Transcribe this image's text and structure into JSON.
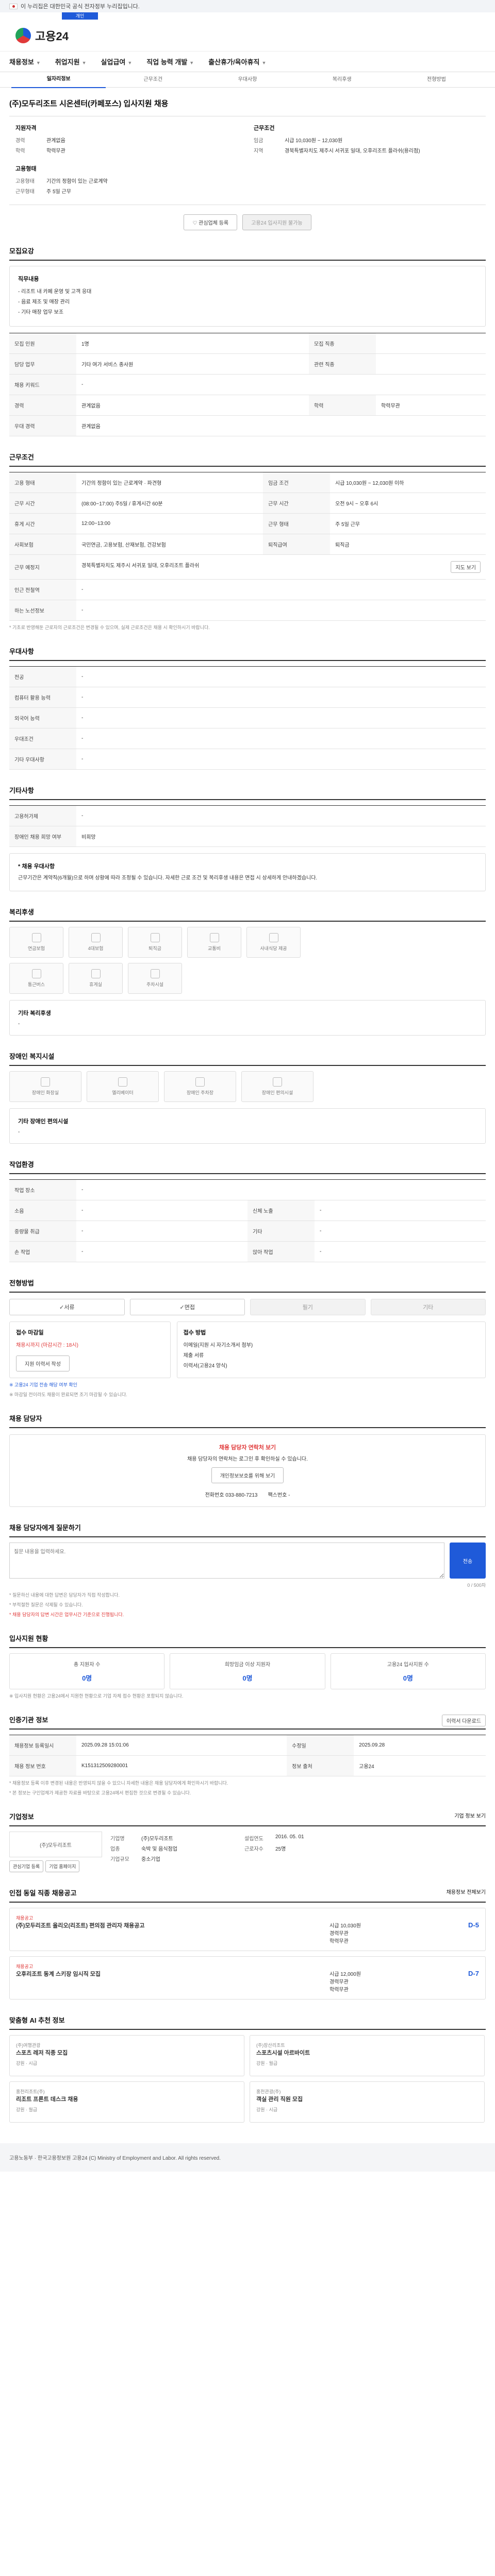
{
  "gov_bar": {
    "text": "이 누리집은 대한민국 공식 전자정부 누리집입니다."
  },
  "top_tab": {
    "label": "개인"
  },
  "logo": {
    "text": "고용24"
  },
  "gnb": [
    "채용정보",
    "취업지원",
    "실업급여",
    "직업 능력 개발",
    "출산휴가/육아휴직"
  ],
  "subnav": [
    "일자리정보",
    "근무조건",
    "우대사항",
    "복리후생",
    "전형방법"
  ],
  "page": {
    "title": "(주)모두리조트 시온센터(카페포스) 입사지원 채용"
  },
  "summary": {
    "left_head": "지원자격",
    "left": [
      {
        "k": "경력",
        "v": "관계없음"
      },
      {
        "k": "학력",
        "v": "학력무관"
      }
    ],
    "right_head": "근무조건",
    "right": [
      {
        "k": "임금",
        "v": "시급 10,030원 ~ 12,030원"
      },
      {
        "k": "지역",
        "v": "경북특별자치도 제주시 서귀포 일대, 오후리조트 플라쉬(용리점)"
      }
    ],
    "left2_head": "고용형태",
    "left2": [
      {
        "k": "고용형태",
        "v": "기간의 정함이 있는 근로계약"
      },
      {
        "k": "근무형태",
        "v": "주 5일 근무"
      }
    ]
  },
  "buttons": {
    "interest": "관심업체 등록",
    "apply": "고용24 입사지원 불가능"
  },
  "job": {
    "section": "모집요강",
    "rows": [
      {
        "k": "모집 인원",
        "v": "1명",
        "k2": "모집 직종",
        "v2": ""
      },
      {
        "k": "담당 업무",
        "v": "기타 여가 서비스 종사원",
        "k2": "관련 직종",
        "v2": ""
      },
      {
        "k": "채용 키워드",
        "v": "-",
        "k2": "",
        "v2": ""
      },
      {
        "k": "경력",
        "v": "관계없음",
        "k2": "학력",
        "v2": "학력무관"
      },
      {
        "k": "우대 경력",
        "v": "관계없음",
        "k2": "",
        "v2": ""
      }
    ],
    "desc_head": "직무내용",
    "desc": [
      "- 리조트 내 카페 운영 및 고객 응대",
      "- 음료 제조 및 매장 관리",
      "- 기타 매장 업무 보조"
    ]
  },
  "conditions": {
    "section": "근무조건",
    "rows": [
      {
        "k": "고용 형태",
        "v": "기간의 정함이 있는 근로계약 · 파견형",
        "k2": "임금 조건",
        "v2": "시급 10,030원 ~ 12,030원 이하"
      },
      {
        "k": "근무 시간",
        "v": "(08:00~17:00) 주5일 / 휴게시간 60분",
        "k2": "근무 시간",
        "v2": "오전 9시 ~ 오후 6시"
      },
      {
        "k": "휴게 시간",
        "v": "12:00~13:00",
        "k2": "근무 형태",
        "v2": "주 5일 근무"
      },
      {
        "k": "사회보험",
        "v": "국민연금, 고용보험, 산재보험, 건강보험",
        "k2": "퇴직급여",
        "v2": "퇴직금"
      },
      {
        "k": "근무 예정지",
        "v": "경북특별자치도 제주시 서귀포 일대, 오후리조트 플라쉬",
        "k2": "",
        "v2": ""
      },
      {
        "k": "인근 전철역",
        "v": "-",
        "k2": "",
        "v2": ""
      },
      {
        "k": "하는 노선정보",
        "v": "-",
        "k2": "",
        "v2": ""
      }
    ],
    "map_btn": "지도 보기",
    "note": "* 기초로 반영해둔 근로자의 근로조건은 변경될 수 있으며, 실제 근로조건은 채용 시 확인하시기 바랍니다."
  },
  "pref": {
    "section": "우대사항",
    "rows": [
      {
        "k": "전공",
        "v": "-"
      },
      {
        "k": "컴퓨터 활용 능력",
        "v": "-"
      },
      {
        "k": "외국어 능력",
        "v": "-"
      },
      {
        "k": "우대조건",
        "v": "-"
      },
      {
        "k": "기타 우대사항",
        "v": "-"
      }
    ]
  },
  "etc": {
    "section": "기타사항",
    "rows": [
      {
        "k": "고용허가제",
        "v": "-"
      },
      {
        "k": "장애인 채용 희망 여부",
        "v": "비희망"
      }
    ],
    "note_head": "* 채용 우대사항",
    "note": "근무기간은 계약직(6개월)으로 하며 상황에 따라 조정될 수 있습니다. 자세한 근로 조건 및 복리후생 내용은 면접 시 상세하게 안내하겠습니다."
  },
  "welfare": {
    "section": "복리후생",
    "tiles": [
      "연금보험",
      "4대보험",
      "퇴직금",
      "교통비",
      "사내식당 제공",
      "통근버스",
      "휴게실",
      "주차시설"
    ],
    "other_head": "기타 복리후생",
    "other": "-"
  },
  "disability": {
    "section": "장애인 복지시설",
    "tiles": [
      "장애인 화장실",
      "엘리베이터",
      "장애인 주차장",
      "장애인 편의시설"
    ],
    "other_head": "기타 장애인 편의시설",
    "other": "-"
  },
  "work_env": {
    "section": "작업환경",
    "rows": [
      {
        "k": "작업 장소",
        "v": "-",
        "k2": "",
        "v2": ""
      },
      {
        "k": "소음",
        "v": "-",
        "k2": "신체 노출",
        "v2": "-"
      },
      {
        "k": "중량물 취급",
        "v": "-",
        "k2": "기타",
        "v2": "-"
      },
      {
        "k": "손 작업",
        "v": "-",
        "k2": "앉아 작업",
        "v2": "-"
      }
    ]
  },
  "selection": {
    "section": "전형방법",
    "methods": [
      "서류",
      "면접",
      "필기",
      "기타"
    ],
    "left": {
      "title": "접수 마감일",
      "date": "채용시까지 (마감시간 : 18시)",
      "btn": "지원 이력서 작성"
    },
    "right": {
      "title": "접수 방법",
      "items": [
        "이메일(지원 시 자기소개서 첨부)",
        "제출 서류",
        "이력서(고용24 양식)"
      ]
    },
    "notes": [
      "※ 고용24 기업 전송 해당 여부 확인",
      "※ 마감일 전이라도 채용이 완료되면 조기 마감될 수 있습니다."
    ]
  },
  "contact": {
    "section": "채용 담당자",
    "alert_title": "채용 담당자 연락처 보기",
    "alert_text": "채용 담당자의 연락처는 로그인 후 확인하실 수 있습니다.",
    "btn": "개인정보보호를 위해 보기",
    "phone_label": "전화번호",
    "phone": "033-880-7213",
    "fax_label": "팩스번호",
    "fax": "-"
  },
  "inquiry": {
    "section": "채용 담당자에게 질문하기",
    "placeholder": "질문 내용을 입력하세요.",
    "counter": "0 / 500자",
    "submit": "전송",
    "notes": [
      "* 질문하신 내용에 대한 답변은 담당자가 직접 작성합니다.",
      "* 부적절한 질문은 삭제될 수 있습니다.",
      "* 채용 담당자의 답변 시간은 업무시간 기준으로 진행됩니다."
    ]
  },
  "status": {
    "section": "입사지원 현황",
    "items": [
      {
        "t": "총 지원자 수",
        "n": "0명"
      },
      {
        "t": "희망임금 이상 지원자",
        "n": "0명"
      },
      {
        "t": "고용24 입사지원 수",
        "n": "0명"
      }
    ],
    "note": "※ 입사지원 현황은 고용24에서 지원한 현황으로 기업 자체 접수 현황은 포함되지 않습니다."
  },
  "manage": {
    "section": "인증기관 정보",
    "print_btn": "이력서 다운로드",
    "rows": [
      {
        "k": "채용정보 등록일시",
        "v": "2025.09.28 15:01:06",
        "k2": "수정일",
        "v2": "2025.09.28"
      },
      {
        "k": "채용 정보 번호",
        "v": "K151312509280001",
        "k2": "정보 출처",
        "v2": "고용24"
      }
    ],
    "notes": [
      "* 채용정보 등록 이후 변경된 내용은 반영되지 않을 수 있으니 자세한 내용은 채용 담당자에게 확인하시기 바랍니다.",
      "* 본 정보는 구인업체가 제공한 자료를 바탕으로 고용24에서 편집한 것으로 변경될 수 있습니다."
    ]
  },
  "company": {
    "section": "기업정보",
    "more": "기업 정보 보기",
    "name": "(주)모두리조트",
    "rows": [
      {
        "k": "기업명",
        "v": "(주)모두리조트",
        "k2": "설립연도",
        "v2": "2016. 05. 01"
      },
      {
        "k": "업종",
        "v": "숙박 및 음식점업",
        "k2": "근로자수",
        "v2": "25명"
      },
      {
        "k": "기업규모",
        "v": "중소기업",
        "k2": "",
        "v2": ""
      }
    ],
    "btns": [
      "관심기업 등록",
      "기업 홈페이지"
    ]
  },
  "similar": {
    "section": "인접 동일 직종 채용공고",
    "more": "채용정보 전체보기",
    "items": [
      {
        "tag": "채용공고",
        "title": "(주)모두리조트 올리오(리조트) 편의점 관리자 채용공고",
        "c1": "시급 10,030원",
        "c2": "경력무관",
        "c3": "학력무관",
        "d": "D-5"
      },
      {
        "tag": "채용공고",
        "title": "오후리조트 동계 스키장 임시직 모집",
        "c1": "시급 12,000원",
        "c2": "경력무관",
        "c3": "학력무관",
        "d": "D-7"
      }
    ]
  },
  "recommend": {
    "section": "맞춤형 AI 추천 정보",
    "items": [
      {
        "tag": "(주)여행관광",
        "title": "스포츠 레저 직종 모집",
        "meta": "강원 · 시급"
      },
      {
        "tag": "(주)장산리조트",
        "title": "스포츠시설 아르바이트",
        "meta": "강원 · 월급"
      },
      {
        "tag": "홍천리조트(주)",
        "title": "리조트 프론트 데스크 채용",
        "meta": "강원 · 월급"
      },
      {
        "tag": "홍천관광(주)",
        "title": "객실 관리 직원 모집",
        "meta": "강원 · 시급"
      }
    ]
  },
  "footer": {
    "text": "고용노동부 · 한국고용정보원 고용24 (C) Ministry of Employment and Labor. All rights reserved."
  },
  "colors": {
    "primary": "#1f5ad9",
    "accent": "#e03a3a",
    "success": "#22a35a"
  }
}
